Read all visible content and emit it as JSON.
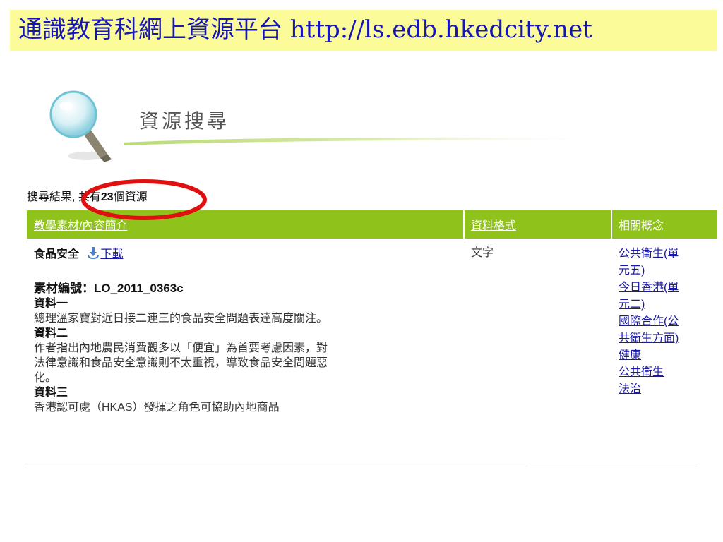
{
  "banner": {
    "text": "通識教育科網上資源平台 http://ls.edb.hkedcity.net"
  },
  "section": {
    "title": "資源搜尋"
  },
  "results": {
    "prefix": "搜尋結果, 共有",
    "count": "23",
    "suffix": "個資源"
  },
  "table": {
    "headers": {
      "material": "教學素材/內容簡介",
      "format": "資料格式",
      "concepts": "相關概念"
    },
    "rows": [
      {
        "title": "食品安全",
        "download_label": "下載",
        "code": "素材編號：LO_2011_0363c",
        "sections": [
          {
            "heading": "資料一",
            "text": "總理溫家寶對近日接二連三的食品安全問題表達高度關注。"
          },
          {
            "heading": "資料二",
            "text": "作者指出內地農民消費觀多以「便宜」為首要考慮因素，對法律意識和食品安全意識則不太重視，導致食品安全問題惡化。"
          },
          {
            "heading": "資料三",
            "text": "香港認可處（HKAS）發揮之角色可協助內地商品"
          }
        ],
        "format": "文字",
        "concepts": [
          "公共衛生(單元五)",
          "今日香港(單元二)",
          "國際合作(公共衛生方面)",
          "健康",
          "公共衛生",
          "法治"
        ]
      }
    ]
  },
  "colors": {
    "banner_bg": "#fbfb9a",
    "banner_text": "#1515b8",
    "header_green": "#8fc21b",
    "highlight_circle": "#e01010",
    "link": "#1a1aa6"
  },
  "icons": {
    "magnifier": "magnifying-glass-icon",
    "download": "download-arrow-icon"
  }
}
